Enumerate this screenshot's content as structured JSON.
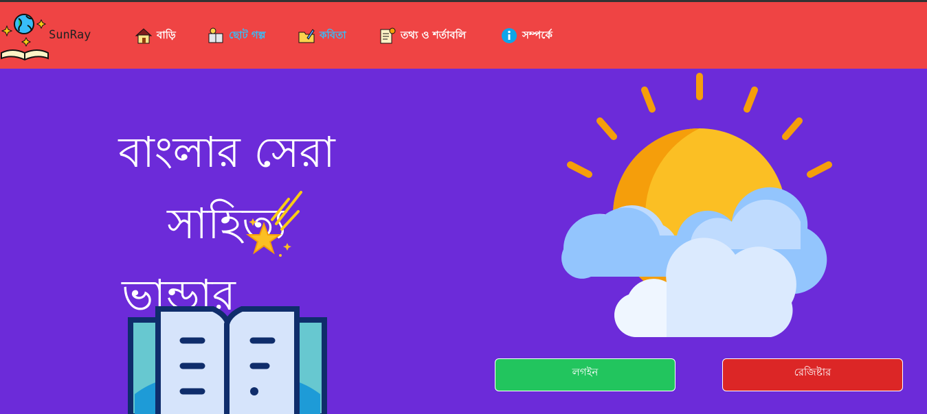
{
  "brand": {
    "name": "SunRay"
  },
  "nav": {
    "items": [
      {
        "label": "বাড়ি",
        "icon": "house-icon"
      },
      {
        "label": "ছোট গল্প",
        "icon": "book-reading-icon"
      },
      {
        "label": "কবিতা",
        "icon": "folder-pen-icon"
      },
      {
        "label": "তথ্য ও শর্তাবলি",
        "icon": "document-info-icon"
      },
      {
        "label": "সম্পর্কে",
        "icon": "info-icon"
      }
    ]
  },
  "hero": {
    "title_line1": "বাংলার সেরা সাহিত্য",
    "title_line2": "ভান্ডার"
  },
  "auth": {
    "login_label": "লগইন",
    "register_label": "রেজিষ্টার"
  },
  "colors": {
    "navbar": "#ef4444",
    "background": "#6c2bd9",
    "login": "#22c55e",
    "register": "#dc2626"
  }
}
